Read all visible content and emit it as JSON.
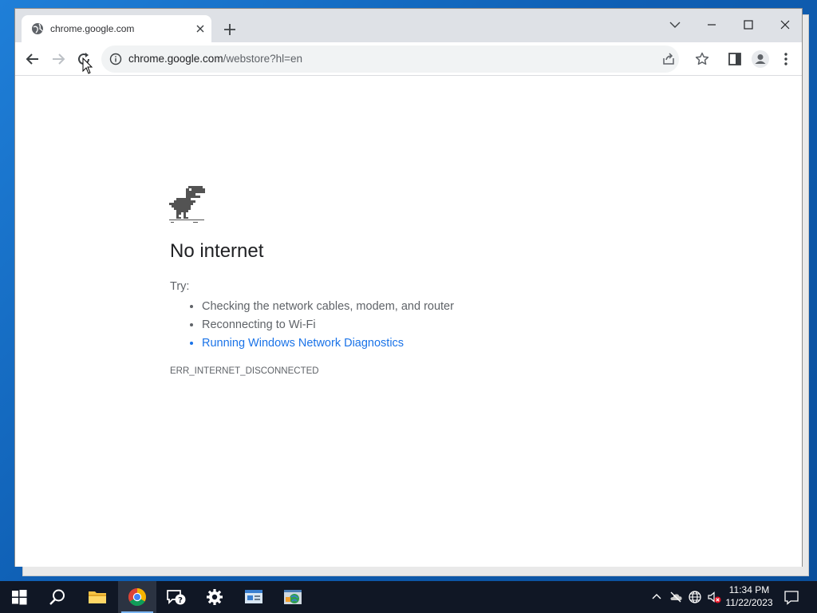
{
  "browser": {
    "tab": {
      "title": "chrome.google.com",
      "favicon": "globe-icon"
    },
    "url": {
      "host": "chrome.google.com",
      "path": "/webstore?hl=en"
    }
  },
  "error_page": {
    "title": "No internet",
    "try_label": "Try:",
    "suggestions": [
      "Checking the network cables, modem, and router",
      "Reconnecting to Wi-Fi",
      "Running Windows Network Diagnostics"
    ],
    "error_code": "ERR_INTERNET_DISCONNECTED"
  },
  "taskbar": {
    "apps": [
      "start-icon",
      "search-icon",
      "file-explorer-icon",
      "chrome-icon",
      "get-help-icon",
      "settings-icon",
      "system-info-icon",
      "network-app-icon"
    ],
    "clock": {
      "time": "11:34 PM",
      "date": "11/22/2023"
    }
  },
  "colors": {
    "link": "#1a73e8",
    "taskbar": "#101725",
    "titlebar": "#dee1e6"
  }
}
